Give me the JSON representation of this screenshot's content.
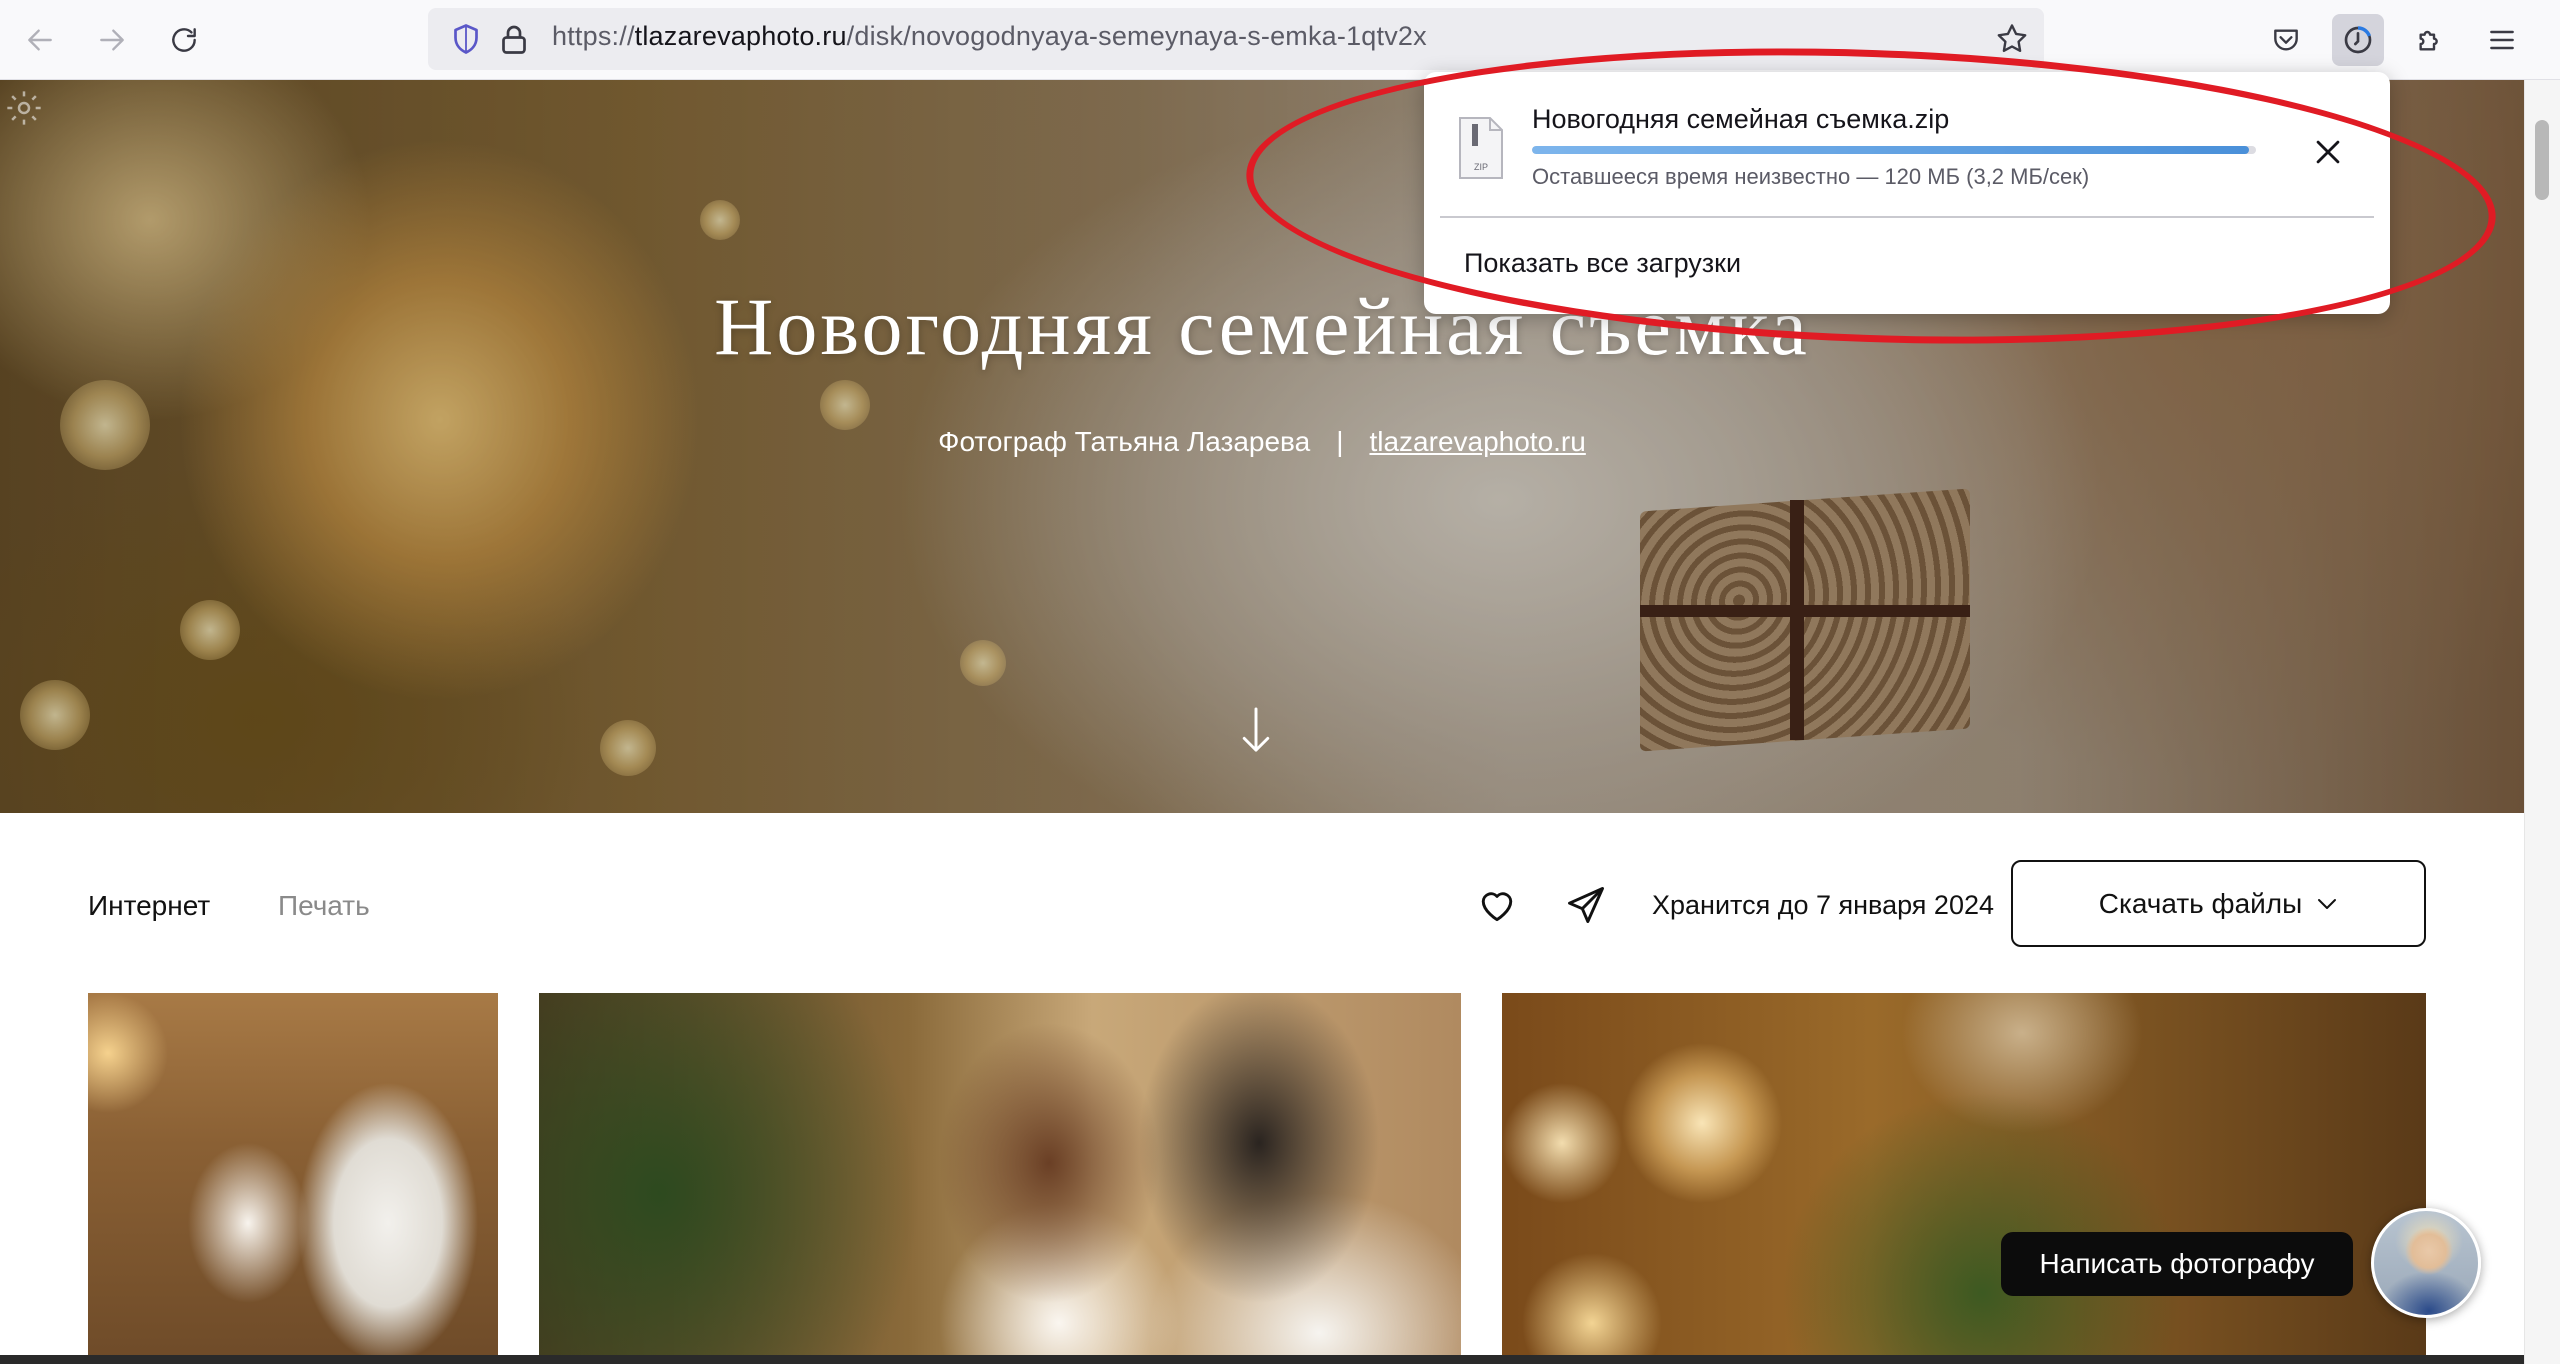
{
  "browser": {
    "url_prefix": "https://",
    "url_host": "tlazarevaphoto.ru",
    "url_path": "/disk/novogodnyaya-semeynaya-s-emka-1qtv2x",
    "icons": {
      "back": "back-arrow-icon",
      "forward": "forward-arrow-icon",
      "reload": "reload-icon",
      "shield": "tracking-protection-shield-icon",
      "lock": "lock-icon",
      "bookmark": "star-icon",
      "pocket": "pocket-icon",
      "downloads": "downloads-progress-icon",
      "extensions": "puzzle-icon",
      "menu": "hamburger-menu-icon"
    }
  },
  "downloads_panel": {
    "filename": "Новогодняя семейная съемка.zip",
    "status": "Оставшееся время неизвестно — 120 МБ (3,2 МБ/сек)",
    "progress": 0.99,
    "show_all": "Показать все загрузки",
    "file_icon_label": "ZIP",
    "progress_color": "#4a90d9"
  },
  "hero": {
    "title": "Новогодняя семейная съемка",
    "photographer": "Фотограф Татьяна Лазарева",
    "separator": "|",
    "site_link": "tlazarevaphoto.ru"
  },
  "gallery_toolbar": {
    "tabs": [
      "Интернет",
      "Печать"
    ],
    "active_tab": "Интернет",
    "stored_until": "Хранится до 7 января 2024",
    "download_button": "Скачать файлы"
  },
  "chat": {
    "button_label": "Написать фотографу"
  },
  "annotation": {
    "color": "#e01b24"
  }
}
